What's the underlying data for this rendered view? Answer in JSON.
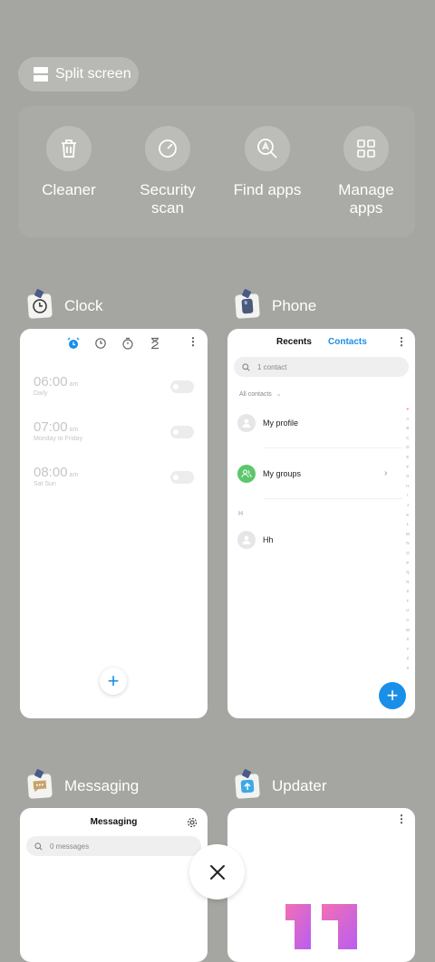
{
  "split_screen": {
    "label": "Split screen",
    "icon": "split-screen-icon"
  },
  "tools": [
    {
      "label_lines": [
        "Cleaner"
      ],
      "icon": "trash-icon"
    },
    {
      "label_lines": [
        "Security",
        "scan"
      ],
      "icon": "security-scan-icon"
    },
    {
      "label_lines": [
        "Find apps"
      ],
      "icon": "find-apps-icon"
    },
    {
      "label_lines": [
        "Manage",
        "apps"
      ],
      "icon": "grid-icon"
    }
  ],
  "clock": {
    "app_name": "Clock",
    "alarms": [
      {
        "time": "06:00",
        "ampm": "am",
        "repeat": "Daily"
      },
      {
        "time": "07:00",
        "ampm": "am",
        "repeat": "Monday to Friday"
      },
      {
        "time": "08:00",
        "ampm": "am",
        "repeat": "Sat Sun"
      }
    ],
    "fab_label": "+"
  },
  "phone": {
    "app_name": "Phone",
    "tabs": {
      "recents": "Recents",
      "contacts": "Contacts"
    },
    "search_placeholder": "1 contact",
    "filter": "All contacts",
    "rows": {
      "profile": "My profile",
      "groups": "My groups",
      "section": "H",
      "contact": "Hh"
    },
    "alphabet": [
      "♥",
      "A",
      "B",
      "C",
      "D",
      "E",
      "F",
      "G",
      "H",
      "I",
      "J",
      "K",
      "L",
      "M",
      "N",
      "O",
      "P",
      "Q",
      "R",
      "S",
      "T",
      "U",
      "V",
      "W",
      "X",
      "Y",
      "Z",
      "#"
    ],
    "fab_label": "+"
  },
  "messaging": {
    "app_name": "Messaging",
    "title": "Messaging",
    "search_placeholder": "0 messages"
  },
  "updater": {
    "app_name": "Updater"
  },
  "colors": {
    "accent": "#1a8fe8",
    "green": "#5dc66b",
    "background": "#a5a5a1"
  }
}
